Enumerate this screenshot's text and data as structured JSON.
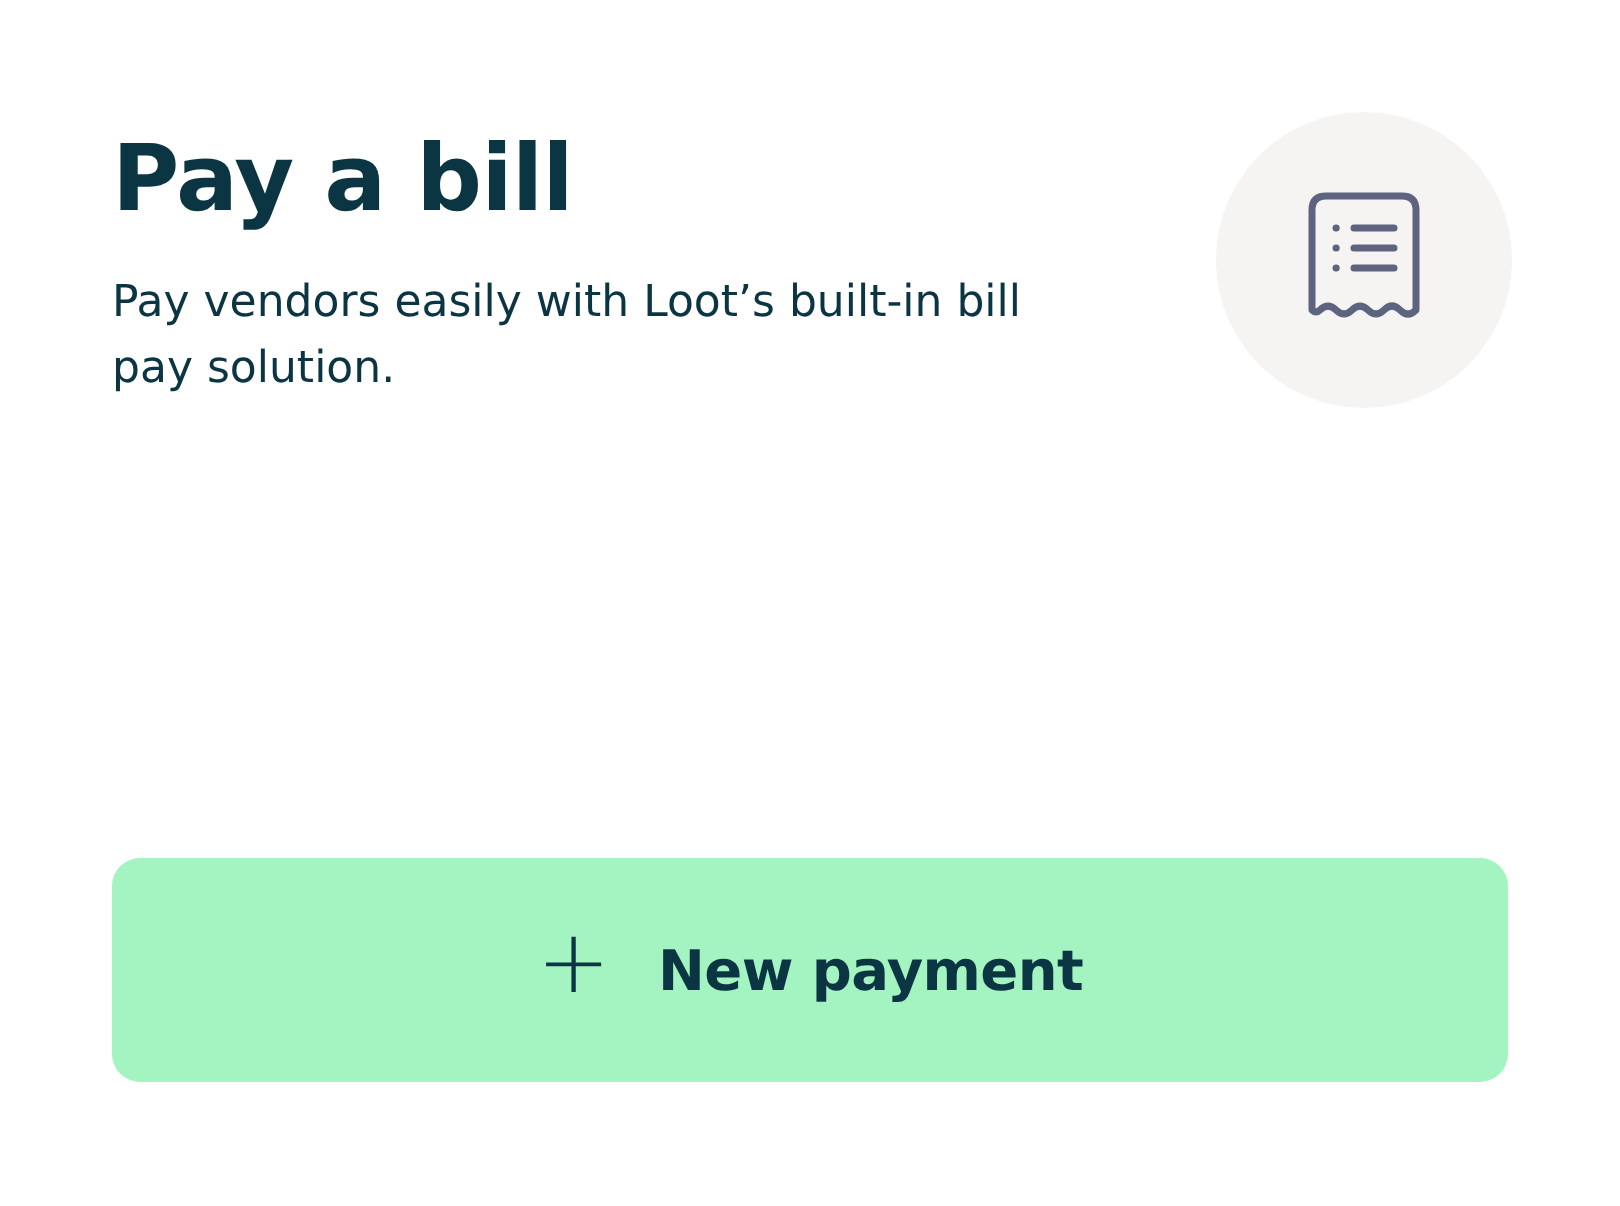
{
  "title": "Pay a bill",
  "description": "Pay vendors easily with Loot’s built-in bill pay solution.",
  "button": {
    "icon": "+",
    "label": "New payment"
  }
}
